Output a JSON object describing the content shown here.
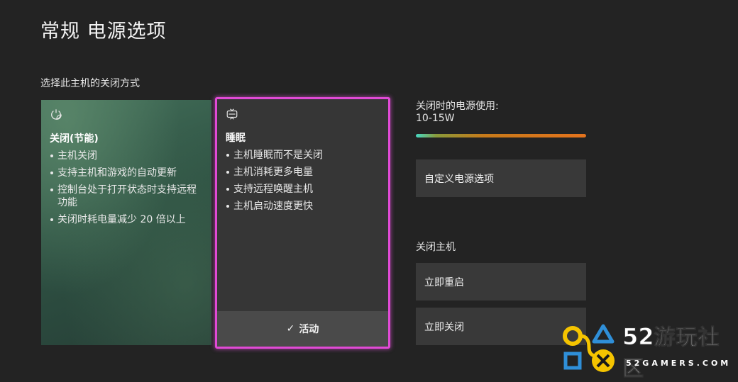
{
  "header": {
    "title": "常规  电源选项"
  },
  "subtitle": "选择此主机的关闭方式",
  "options": {
    "shutdown": {
      "title": "关闭(节能)",
      "icon": "power-leaf-icon",
      "bullets": [
        "主机关闭",
        "支持主机和游戏的自动更新",
        "控制台处于打开状态时支持远程功能",
        "关闭时耗电量减少 20 倍以上"
      ]
    },
    "sleep": {
      "title": "睡眠",
      "icon": "console-sleep-icon",
      "bullets": [
        "主机睡眠而不是关闭",
        "主机消耗更多电量",
        "支持远程唤醒主机",
        "主机启动速度更快"
      ],
      "active_label": "活动",
      "selected": true
    }
  },
  "power_usage": {
    "label": "关闭时的电源使用:",
    "value": "10-15W",
    "level": 1.0
  },
  "buttons": {
    "custom": "自定义电源选项",
    "restart": "立即重启",
    "shutdown_now": "立即关闭"
  },
  "shutdown_section": "关闭主机",
  "watermark": {
    "text_num": "52",
    "text_cn": "游玩社区",
    "sub": "52GAMERS.COM"
  },
  "colors": {
    "accent": "#e14ad6",
    "background": "#232323",
    "card_green": "#2f5344"
  }
}
